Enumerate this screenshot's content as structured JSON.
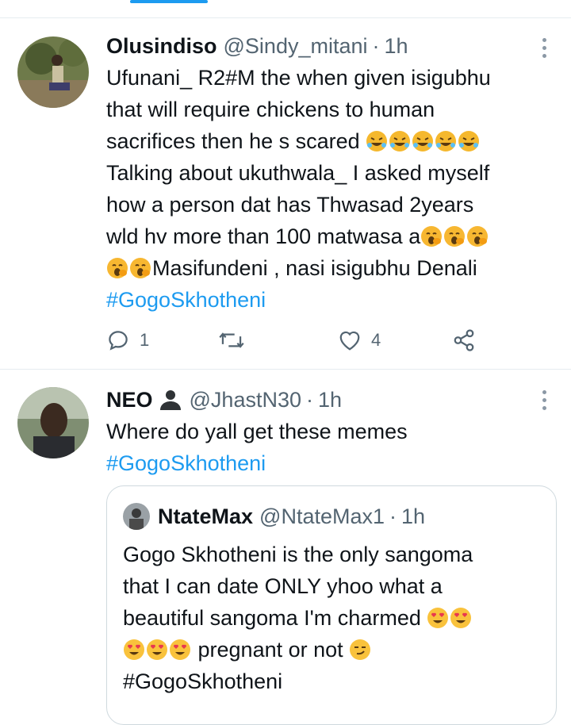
{
  "tweets": [
    {
      "name": "Olusindiso",
      "handle": "@Sindy_mitani",
      "separator": "·",
      "time": "1h",
      "lines": [
        "Ufunani_ R2#M the  when given isigubhu",
        "that will require chickens to human",
        "sacrifices then he s scared",
        "Talking about ukuthwala_ I asked myself",
        "how a person dat has Thwasad 2years",
        "wld hv more than 100 matwasa a",
        "Masifundeni , nasi isigubhu Denali"
      ],
      "hashtag": "#GogoSkhotheni",
      "replies": "1",
      "retweets": "",
      "likes": "4"
    },
    {
      "name": "NEO",
      "handle": "@JhastN30",
      "separator": "·",
      "time": "1h",
      "text": "Where do yall get these memes",
      "hashtag": "#GogoSkhotheni",
      "quote": {
        "name": "NtateMax",
        "handle": "@NtateMax1",
        "separator": "·",
        "time": "1h",
        "lines": [
          "Gogo Skhotheni is the only sangoma",
          "that I can date ONLY yhoo what a",
          "beautiful sangoma I'm charmed",
          "pregnant or not",
          "#GogoSkhotheni"
        ]
      }
    }
  ],
  "icons": {
    "reply": "reply-icon",
    "retweet": "retweet-icon",
    "like": "heart-icon",
    "share": "share-icon",
    "more": "more-icon",
    "emoji_laugh": "rofl-emoji",
    "emoji_yawn": "yawning-emoji",
    "emoji_heart_eyes": "heart-eyes-emoji",
    "emoji_smirk": "smirk-emoji",
    "person": "person-silhouette-emoji"
  },
  "colors": {
    "accent": "#1d9bf0",
    "text": "#0f1419",
    "secondary": "#536471",
    "border": "#cfd9de"
  }
}
